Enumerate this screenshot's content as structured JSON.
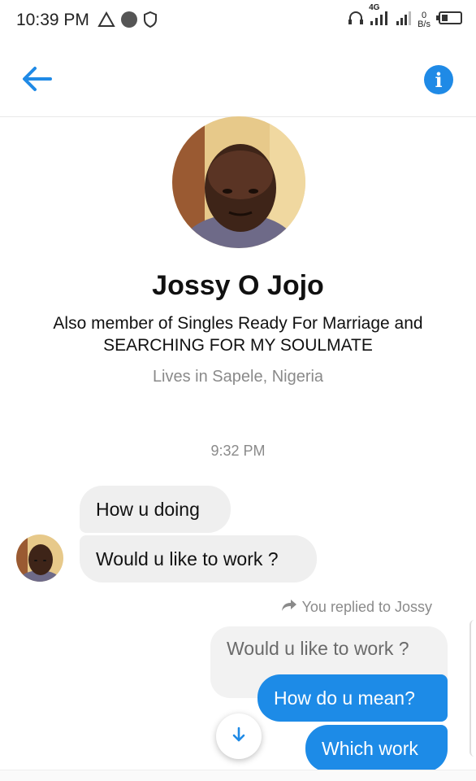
{
  "status_bar": {
    "time": "10:39 PM",
    "network_type": "4G",
    "net_speed_value": "0",
    "net_speed_unit": "B/s",
    "icons": [
      "warning-triangle-icon",
      "circle-icon",
      "shield-icon",
      "headphones-icon",
      "signal-icon",
      "signal-icon-2",
      "battery-icon"
    ]
  },
  "header": {
    "back_icon": "back-arrow-icon",
    "info_icon": "info-icon",
    "info_glyph": "i",
    "accent_color": "#1f8ae6"
  },
  "profile": {
    "name": "Jossy O Jojo",
    "bio_line1": "Also member of Singles Ready For Marriage and",
    "bio_line2": "SEARCHING FOR MY SOULMATE",
    "location": "Lives in Sapele, Nigeria"
  },
  "conversation": {
    "timestamp": "9:32 PM",
    "incoming": [
      {
        "text": "How u doing"
      },
      {
        "text": "Would u like to work ?"
      }
    ],
    "replied_label": "You replied to Jossy",
    "quoted_text": "Would u like to work ?",
    "outgoing": [
      {
        "text": "How do u mean?"
      },
      {
        "text": "Which work"
      }
    ],
    "outgoing_color": "#1d8be7",
    "incoming_color": "#efefef"
  }
}
